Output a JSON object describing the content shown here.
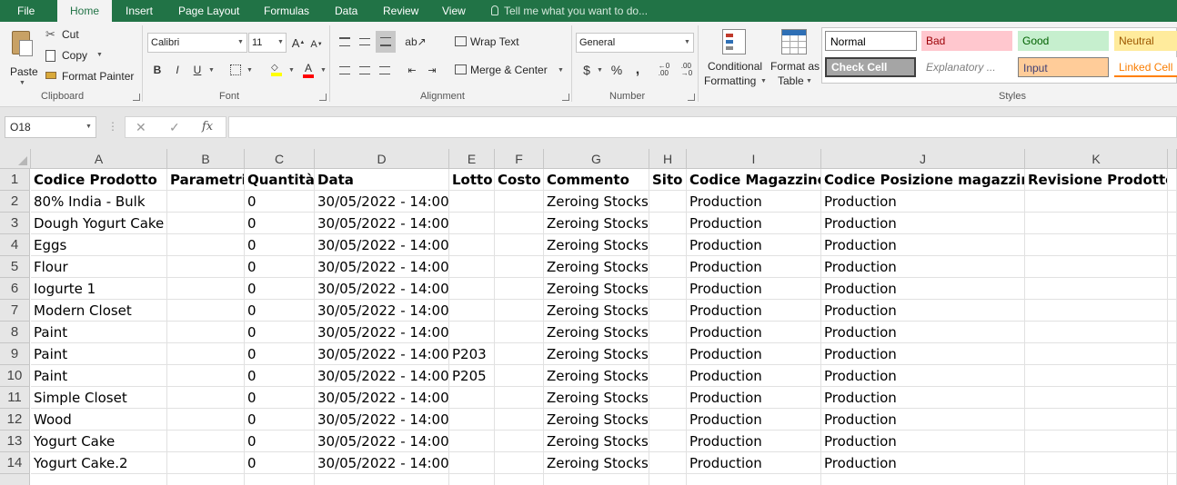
{
  "tabs": [
    "File",
    "Home",
    "Insert",
    "Page Layout",
    "Formulas",
    "Data",
    "Review",
    "View"
  ],
  "active_tab": "Home",
  "tell_me": "Tell me what you want to do...",
  "clipboard": {
    "paste": "Paste",
    "cut": "Cut",
    "copy": "Copy",
    "format_painter": "Format Painter",
    "label": "Clipboard"
  },
  "font": {
    "name": "Calibri",
    "size": "11",
    "label": "Font",
    "bold": "B",
    "italic": "I",
    "underline": "U"
  },
  "alignment": {
    "wrap_text": "Wrap Text",
    "merge_center": "Merge & Center",
    "label": "Alignment"
  },
  "number": {
    "format": "General",
    "currency": "$",
    "percent": "%",
    "comma": ",",
    "label": "Number"
  },
  "styles_group": {
    "conditional_formatting": [
      "Conditional",
      "Formatting"
    ],
    "format_as_table": [
      "Format as",
      "Table"
    ],
    "label": "Styles",
    "cells": [
      {
        "name": "Normal",
        "bg": "#ffffff",
        "fg": "#000000"
      },
      {
        "name": "Bad",
        "bg": "#ffc7ce",
        "fg": "#9c0006"
      },
      {
        "name": "Good",
        "bg": "#c6efce",
        "fg": "#006100"
      },
      {
        "name": "Neutral",
        "bg": "#ffeb9c",
        "fg": "#9c5700"
      },
      {
        "name": "Check Cell",
        "bg": "#a5a5a5",
        "fg": "#ffffff"
      },
      {
        "name": "Explanatory ...",
        "bg": "#ffffff",
        "fg": "#7f7f7f"
      },
      {
        "name": "Input",
        "bg": "#ffcc99",
        "fg": "#3f3f76"
      },
      {
        "name": "Linked Cell",
        "bg": "#ffffff",
        "fg": "#fa7d00"
      }
    ]
  },
  "formula_bar": {
    "name_box": "O18",
    "cancel": "✕",
    "enter": "✓",
    "fx": "fx",
    "content": ""
  },
  "columns": [
    "A",
    "B",
    "C",
    "D",
    "E",
    "F",
    "G",
    "H",
    "I",
    "J",
    "K"
  ],
  "rows": [
    "1",
    "2",
    "3",
    "4",
    "5",
    "6",
    "7",
    "8",
    "9",
    "10",
    "11",
    "12",
    "13",
    "14"
  ],
  "table": {
    "headers": [
      "Codice Prodotto",
      "Parametri",
      "Quantità",
      "Data",
      "Lotto",
      "Costo",
      "Commento",
      "Sito",
      "Codice Magazzino",
      "Codice Posizione magazzino",
      "Revisione Prodotto"
    ],
    "rows": [
      [
        "80% India - Bulk",
        "",
        "0",
        "30/05/2022 - 14:00",
        "",
        "",
        "Zeroing Stocks",
        "",
        "Production",
        "Production",
        ""
      ],
      [
        "Dough Yogurt Cake",
        "",
        "0",
        "30/05/2022 - 14:00",
        "",
        "",
        "Zeroing Stocks",
        "",
        "Production",
        "Production",
        ""
      ],
      [
        "Eggs",
        "",
        "0",
        "30/05/2022 - 14:00",
        "",
        "",
        "Zeroing Stocks",
        "",
        "Production",
        "Production",
        ""
      ],
      [
        "Flour",
        "",
        "0",
        "30/05/2022 - 14:00",
        "",
        "",
        "Zeroing Stocks",
        "",
        "Production",
        "Production",
        ""
      ],
      [
        "Iogurte 1",
        "",
        "0",
        "30/05/2022 - 14:00",
        "",
        "",
        "Zeroing Stocks",
        "",
        "Production",
        "Production",
        ""
      ],
      [
        "Modern Closet",
        "",
        "0",
        "30/05/2022 - 14:00",
        "",
        "",
        "Zeroing Stocks",
        "",
        "Production",
        "Production",
        ""
      ],
      [
        "Paint",
        "",
        "0",
        "30/05/2022 - 14:00",
        "",
        "",
        "Zeroing Stocks",
        "",
        "Production",
        "Production",
        ""
      ],
      [
        "Paint",
        "",
        "0",
        "30/05/2022 - 14:00",
        "P203",
        "",
        "Zeroing Stocks",
        "",
        "Production",
        "Production",
        ""
      ],
      [
        "Paint",
        "",
        "0",
        "30/05/2022 - 14:00",
        "P205",
        "",
        "Zeroing Stocks",
        "",
        "Production",
        "Production",
        ""
      ],
      [
        "Simple Closet",
        "",
        "0",
        "30/05/2022 - 14:00",
        "",
        "",
        "Zeroing Stocks",
        "",
        "Production",
        "Production",
        ""
      ],
      [
        "Wood",
        "",
        "0",
        "30/05/2022 - 14:00",
        "",
        "",
        "Zeroing Stocks",
        "",
        "Production",
        "Production",
        ""
      ],
      [
        "Yogurt Cake",
        "",
        "0",
        "30/05/2022 - 14:00",
        "",
        "",
        "Zeroing Stocks",
        "",
        "Production",
        "Production",
        ""
      ],
      [
        "Yogurt Cake.2",
        "",
        "0",
        "30/05/2022 - 14:00",
        "",
        "",
        "Zeroing Stocks",
        "",
        "Production",
        "Production",
        ""
      ]
    ]
  },
  "colors": {
    "accent": "#217346",
    "ribbon": "#f3f3f3",
    "grid_line": "#e1e1e1",
    "header_bg": "#e6e6e6"
  }
}
